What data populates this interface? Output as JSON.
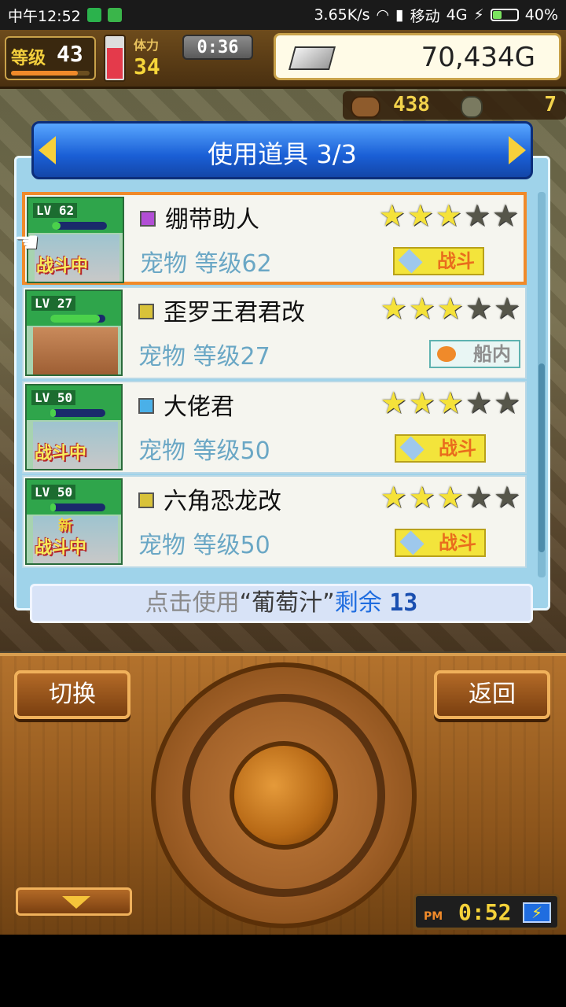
{
  "status_bar": {
    "time": "中午12:52",
    "speed": "3.65K/s",
    "carrier": "移动",
    "network": "4G",
    "battery": "40%",
    "battery_level": 0.4
  },
  "hud": {
    "level_label": "等级",
    "level": "43",
    "level_progress": 0.85,
    "stamina_label": "体力",
    "stamina": "34",
    "stamina_level": 0.7,
    "timer": "0:36",
    "gold": "70,434G",
    "resource_1": "438",
    "resource_2": "7"
  },
  "dialog": {
    "title": "使用道具 3/3",
    "items": [
      {
        "lv": "LV 62",
        "status": "战斗中",
        "element_color": "#b24ed6",
        "name": "绷带助人",
        "level_text": "宠物 等级62",
        "stars": 3,
        "tag": "战斗",
        "selected": true,
        "new": "",
        "hp": 0.15,
        "face": false
      },
      {
        "lv": "LV 27",
        "status": "",
        "element_color": "#d8c23a",
        "name": "歪罗王君君改",
        "level_text": "宠物 等级27",
        "stars": 3,
        "tag": "船内",
        "selected": false,
        "new": "",
        "hp": 0.9,
        "face": true
      },
      {
        "lv": "LV 50",
        "status": "战斗中",
        "element_color": "#4ab0e8",
        "name": "大佬君",
        "level_text": "宠物 等级50",
        "stars": 3,
        "tag": "战斗",
        "selected": false,
        "new": "",
        "hp": 0.1,
        "face": false
      },
      {
        "lv": "LV 50",
        "status": "战斗中",
        "element_color": "#d8c23a",
        "name": "六角恐龙改",
        "level_text": "宠物 等级50",
        "stars": 3,
        "tag": "战斗",
        "selected": false,
        "new": "新",
        "hp": 0.1,
        "face": false
      }
    ],
    "info_prefix": "点击使用",
    "info_item": "“葡萄汁”",
    "info_remain": "剩余",
    "info_count": "13"
  },
  "controls": {
    "switch_label": "切换",
    "back_label": "返回",
    "clock_ampm": "PM",
    "clock_time": "0:52"
  }
}
